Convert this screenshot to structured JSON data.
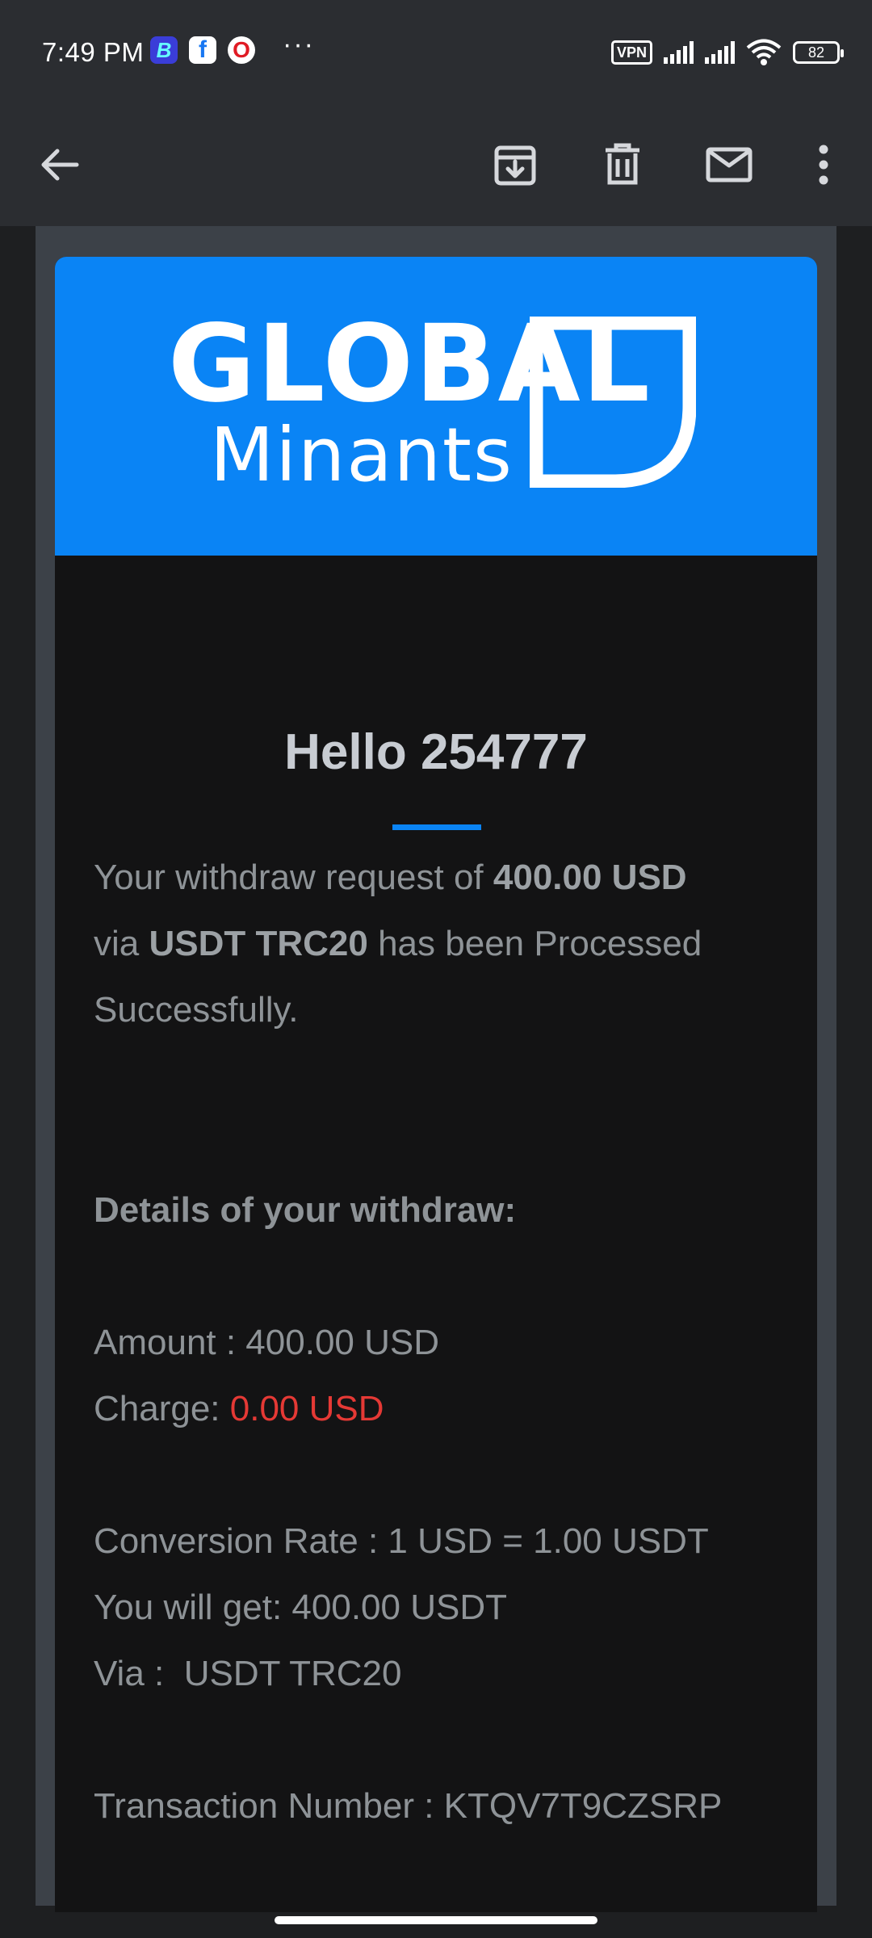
{
  "status_bar": {
    "time": "7:49 PM",
    "more_indicator": "···",
    "vpn_label": "VPN",
    "battery_level": "82"
  },
  "app_bar": {
    "icons": [
      "back-arrow-icon",
      "archive-icon",
      "delete-icon",
      "mark-unread-icon",
      "more-vert-icon"
    ]
  },
  "email": {
    "logo": {
      "line1": "GLOBAL",
      "line2": "Minants"
    },
    "greeting": "Hello 254777",
    "intro": {
      "part1": "Your withdraw request of ",
      "amount": "400.00 USD",
      "part2": "via ",
      "method": "USDT TRC20",
      "part3": " has been Processed Successfully."
    },
    "details_heading": "Details of your withdraw:",
    "amount_line": "Amount : 400.00 USD",
    "charge_label": "Charge: ",
    "charge_value": "0.00 USD",
    "conversion_line": "Conversion Rate : 1 USD = 1.00 USDT",
    "get_line": "You will get: 400.00 USDT",
    "via_line": "Via :  USDT TRC20",
    "transaction_line": "Transaction Number : KTQV7T9CZSRP"
  },
  "colors": {
    "banner": "#0a84f5",
    "charge_value": "#e53935",
    "card_bg": "#131314"
  }
}
